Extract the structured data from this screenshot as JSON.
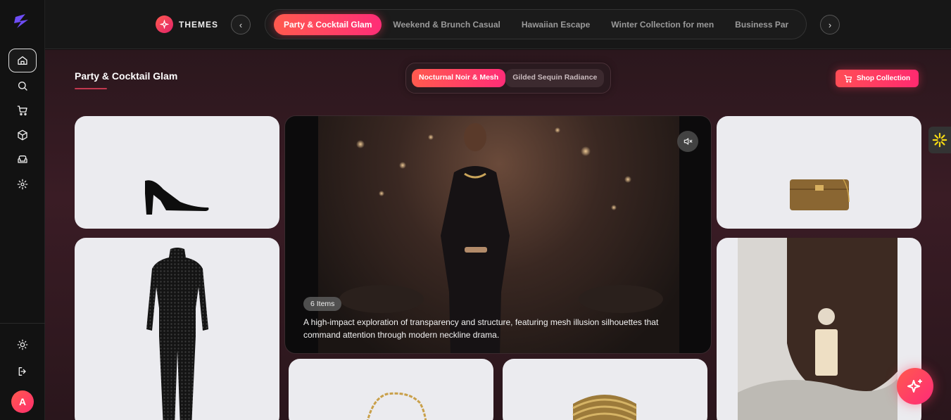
{
  "topbar": {
    "themes_label": "THEMES",
    "tabs": [
      {
        "label": "Party & Cocktail Glam",
        "active": true
      },
      {
        "label": "Weekend & Brunch Casual",
        "active": false
      },
      {
        "label": "Hawaiian Escape",
        "active": false
      },
      {
        "label": "Winter Collection for men",
        "active": false
      },
      {
        "label": "Business Par",
        "active": false
      }
    ]
  },
  "main": {
    "title": "Party & Cocktail Glam",
    "sub_tabs": [
      {
        "label": "Nocturnal Noir & Mesh",
        "active": true
      },
      {
        "label": "Gilded Sequin Radiance",
        "active": false
      }
    ],
    "shop_label": "Shop Collection",
    "hero": {
      "items_badge": "6 Items",
      "description": "A high-impact exploration of transparency and structure, featuring mesh illusion silhouettes that command attention through modern neckline drama."
    }
  },
  "sidebar": {
    "avatar_initial": "A",
    "icons": [
      "home-icon",
      "search-icon",
      "cart-icon",
      "box-icon",
      "sofa-icon",
      "settings-icon",
      "sun-icon",
      "logout-icon"
    ]
  },
  "colors": {
    "accent": "#ff2d77",
    "accent_start": "#ff5a4e",
    "background": "#2b171d"
  }
}
